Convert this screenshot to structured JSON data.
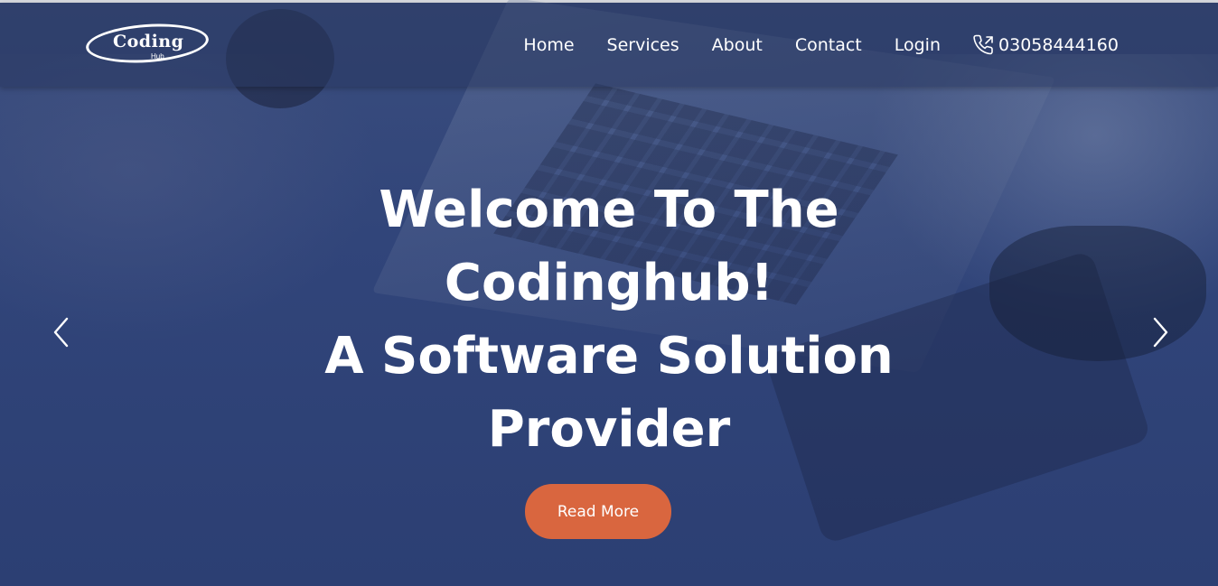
{
  "brand": {
    "logo_text": "Coding",
    "logo_subtext": "Hub"
  },
  "nav": {
    "items": [
      {
        "label": "Home"
      },
      {
        "label": "Services"
      },
      {
        "label": "About"
      },
      {
        "label": "Contact"
      },
      {
        "label": "Login"
      }
    ],
    "phone": {
      "icon": "phone-call-icon",
      "number": "03058444160"
    }
  },
  "hero": {
    "headline_lines": [
      "Welcome To The",
      "Codinghub!",
      "A Software Solution",
      "Provider"
    ],
    "cta_label": "Read More"
  },
  "carousel": {
    "prev_icon": "chevron-left-icon",
    "next_icon": "chevron-right-icon"
  },
  "colors": {
    "overlay": "#2c3f73",
    "cta": "#d9663f",
    "text": "#ffffff"
  }
}
